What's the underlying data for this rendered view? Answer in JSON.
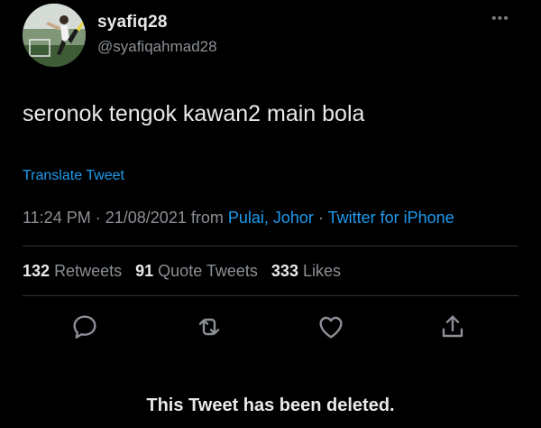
{
  "user": {
    "display_name": "syafiq28",
    "handle": "@syafiqahmad28"
  },
  "tweet": {
    "text": "seronok tengok kawan2 main bola",
    "translate_label": "Translate Tweet",
    "time": "11:24 PM",
    "date": "21/08/2021",
    "from_label": "from",
    "location": "Pulai, Johor",
    "client": "Twitter for iPhone",
    "separator": "·"
  },
  "stats": {
    "retweets_count": "132",
    "retweets_label": "Retweets",
    "quotes_count": "91",
    "quotes_label": "Quote Tweets",
    "likes_count": "333",
    "likes_label": "Likes"
  },
  "actions": {
    "icons": [
      "reply-icon",
      "retweet-icon",
      "like-icon",
      "share-icon"
    ]
  },
  "notice": {
    "deleted_text": "This Tweet has been deleted."
  },
  "colors": {
    "background": "#000000",
    "text_primary": "#e7e9ea",
    "text_secondary": "#8b9096",
    "accent_link": "#1d9bf0",
    "divider": "#2f3336"
  }
}
